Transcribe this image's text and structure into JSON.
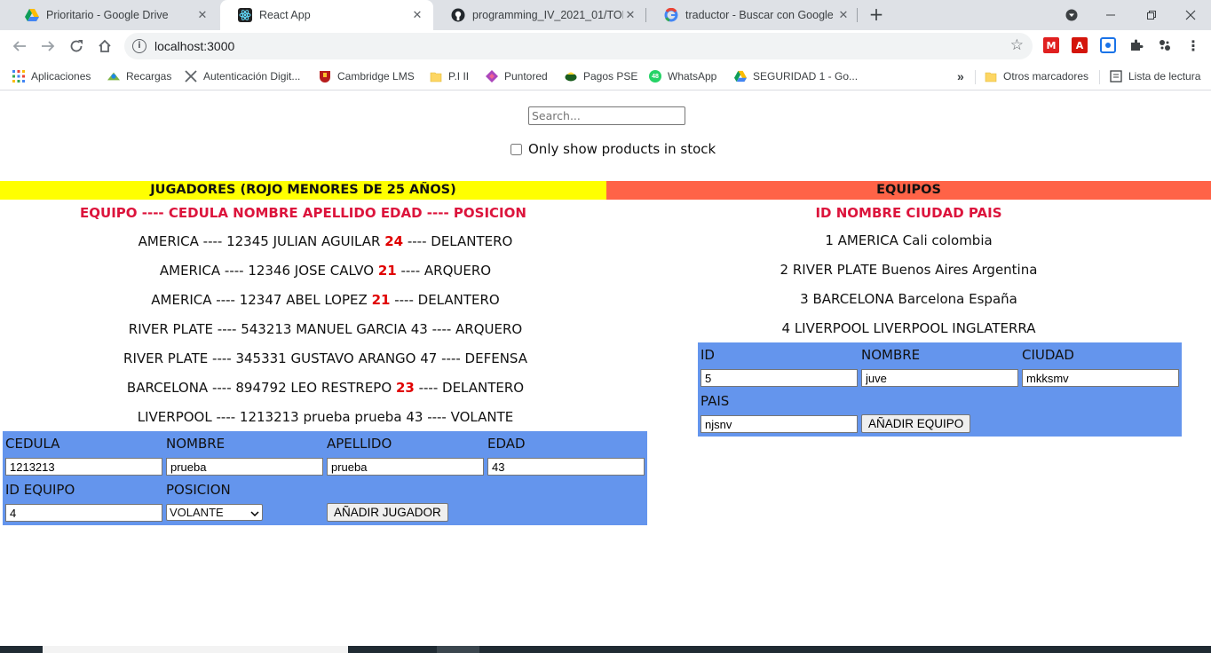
{
  "browser": {
    "tabs": [
      {
        "label": "Prioritario - Google Drive",
        "icon": "google-drive-icon",
        "active": false
      },
      {
        "label": "React App",
        "icon": "react-icon",
        "active": true
      },
      {
        "label": "programming_IV_2021_01/TODO",
        "icon": "github-icon",
        "active": false
      },
      {
        "label": "traductor - Buscar con Google",
        "icon": "google-icon",
        "active": false
      }
    ],
    "new_tab": "+",
    "url": "localhost:3000",
    "bookmarks": [
      {
        "label": "Aplicaciones",
        "icon": "apps-grid-icon"
      },
      {
        "label": "Recargas",
        "icon": "recargas-icon"
      },
      {
        "label": "Autenticación Digit...",
        "icon": "autenticacion-icon"
      },
      {
        "label": "Cambridge LMS",
        "icon": "cambridge-icon"
      },
      {
        "label": "P.I II",
        "icon": "folder-icon"
      },
      {
        "label": "Puntored",
        "icon": "puntored-icon"
      },
      {
        "label": "Pagos PSE",
        "icon": "pse-icon"
      },
      {
        "label": "WhatsApp",
        "icon": "whatsapp-icon"
      },
      {
        "label": "SEGURIDAD 1 - Go...",
        "icon": "google-drive-icon"
      }
    ],
    "bookmarks_overflow": "»",
    "other_bookmarks": "Otros marcadores",
    "reading_list": "Lista de lectura",
    "colors": {
      "tabstrip": "#dee1e6",
      "omnibox": "#f1f3f4"
    }
  },
  "search": {
    "placeholder": "Search...",
    "value": ""
  },
  "stock_filter": {
    "label": "Only show products in stock",
    "checked": false
  },
  "jugadores": {
    "title": "JUGADORES (ROJO MENORES DE 25 AÑOS)",
    "header_color": "#ffff00",
    "columns": "EQUIPO ---- CEDULA NOMBRE APELLIDO EDAD ---- POSICION",
    "rows": [
      {
        "before": "AMERICA ---- 12345 JULIAN AGUILAR",
        "age": "24",
        "after": "---- DELANTERO",
        "young": true
      },
      {
        "before": "AMERICA ---- 12346 JOSE CALVO",
        "age": "21",
        "after": "---- ARQUERO",
        "young": true
      },
      {
        "before": "AMERICA ---- 12347 ABEL LOPEZ",
        "age": "21",
        "after": "---- DELANTERO",
        "young": true
      },
      {
        "before": "RIVER PLATE ---- 543213 MANUEL GARCIA",
        "age": "43",
        "after": "---- ARQUERO",
        "young": false
      },
      {
        "before": "RIVER PLATE ---- 345331 GUSTAVO ARANGO",
        "age": "47",
        "after": "---- DEFENSA",
        "young": false
      },
      {
        "before": "BARCELONA ---- 894792 LEO RESTREPO",
        "age": "23",
        "after": "---- DELANTERO",
        "young": true
      },
      {
        "before": "LIVERPOOL ---- 1213213 prueba prueba",
        "age": "43",
        "after": "---- VOLANTE",
        "young": false
      }
    ],
    "form": {
      "cedula_label": "CEDULA",
      "cedula_value": "1213213",
      "nombre_label": "NOMBRE",
      "nombre_value": "prueba",
      "apellido_label": "APELLIDO",
      "apellido_value": "prueba",
      "edad_label": "EDAD",
      "edad_value": "43",
      "id_equipo_label": "ID EQUIPO",
      "id_equipo_value": "4",
      "posicion_label": "POSICION",
      "posicion_value": "VOLANTE",
      "submit_label": "AÑADIR JUGADOR"
    }
  },
  "equipos": {
    "title": "EQUIPOS",
    "header_color": "#ff6347",
    "columns": "ID NOMBRE CIUDAD PAIS",
    "rows": [
      "1 AMERICA Cali colombia",
      "2 RIVER PLATE Buenos Aires Argentina",
      "3 BARCELONA Barcelona España",
      "4 LIVERPOOL LIVERPOOL INGLATERRA"
    ],
    "form": {
      "id_label": "ID",
      "id_value": "5",
      "nombre_label": "NOMBRE",
      "nombre_value": "juve",
      "ciudad_label": "CIUDAD",
      "ciudad_value": "mkksmv",
      "pais_label": "PAIS",
      "pais_value": "njsnv",
      "submit_label": "AÑADIR EQUIPO"
    }
  },
  "form_color": "#6495ed"
}
